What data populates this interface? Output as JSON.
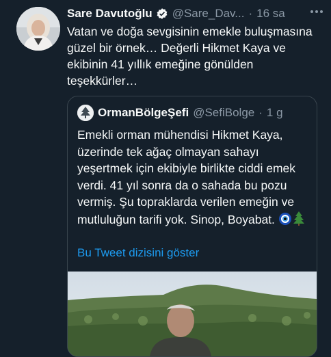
{
  "tweet": {
    "name": "Sare Davutoğlu",
    "handle": "@Sare_Dav...",
    "separator": "·",
    "time": "16 sa",
    "text": "Vatan ve doğa sevgisinin emekle buluşmasına güzel bir örnek… Değerli Hikmet Kaya ve ekibinin 41 yıllık emeğine gönülden teşekkürler…"
  },
  "quote": {
    "name": "OrmanBölgeŞefi",
    "handle": "@SefiBolge",
    "separator": "·",
    "time": "1 g",
    "text": "Emekli orman mühendisi Hikmet Kaya, üzerinde tek ağaç olmayan sahayı yeşertmek için ekibiyle birlikte ciddi emek verdi. 41 yıl sonra da o sahada bu pozu vermiş. Şu topraklarda verilen emeğin ve mutluluğun tarifi yok. Sinop, Boyabat.",
    "emojis": [
      "nazar-amulet-emoji",
      "evergreen-tree-emoji"
    ],
    "thread_link": "Bu Tweet dizisini göster"
  },
  "colors": {
    "background": "#15202b",
    "text": "#f7f9f9",
    "secondary": "#8b98a5",
    "accent": "#1d9bf0",
    "border": "#38444d"
  }
}
